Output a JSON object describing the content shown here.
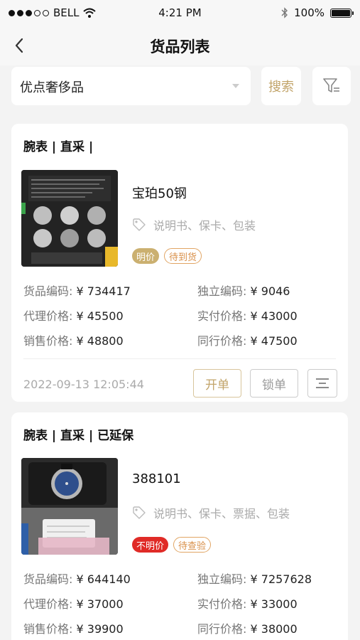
{
  "status_bar": {
    "carrier": "BELL",
    "time": "4:21 PM",
    "battery": "100%"
  },
  "header": {
    "title": "货品列表"
  },
  "search": {
    "shop": "优点奢侈品",
    "search_label": "搜索"
  },
  "items": [
    {
      "title": "腕表 | 直采 |",
      "name": "宝珀50钢",
      "accessories": "说明书、保卡、包装",
      "price_badge": "明价",
      "status_badge": "待到货",
      "fields": [
        {
          "label": "货品编码:",
          "value": "¥ 734417"
        },
        {
          "label": "独立编码:",
          "value": "¥ 9046"
        },
        {
          "label": "代理价格:",
          "value": "¥ 45500"
        },
        {
          "label": "实付价格:",
          "value": "¥ 43000"
        },
        {
          "label": "销售价格:",
          "value": "¥ 48800"
        },
        {
          "label": "同行价格:",
          "value": "¥ 47500"
        }
      ],
      "timestamp": "2022-09-13 12:05:44",
      "open_label": "开单",
      "lock_label": "锁单"
    },
    {
      "title": "腕表 | 直采 | 已延保",
      "name": "388101",
      "accessories": "说明书、保卡、票据、包装",
      "price_badge": "不明价",
      "status_badge": "待查验",
      "fields": [
        {
          "label": "货品编码:",
          "value": "¥ 644140"
        },
        {
          "label": "独立编码:",
          "value": "¥ 7257628"
        },
        {
          "label": "代理价格:",
          "value": "¥ 37000"
        },
        {
          "label": "实付价格:",
          "value": "¥ 33000"
        },
        {
          "label": "销售价格:",
          "value": "¥ 39900"
        },
        {
          "label": "同行价格:",
          "value": "¥ 38000"
        }
      ]
    }
  ],
  "colors": {
    "accent": "#c2a46a",
    "background": "#f3f3f3",
    "red_badge": "#e02b27",
    "gold_badge": "#cbb070"
  }
}
